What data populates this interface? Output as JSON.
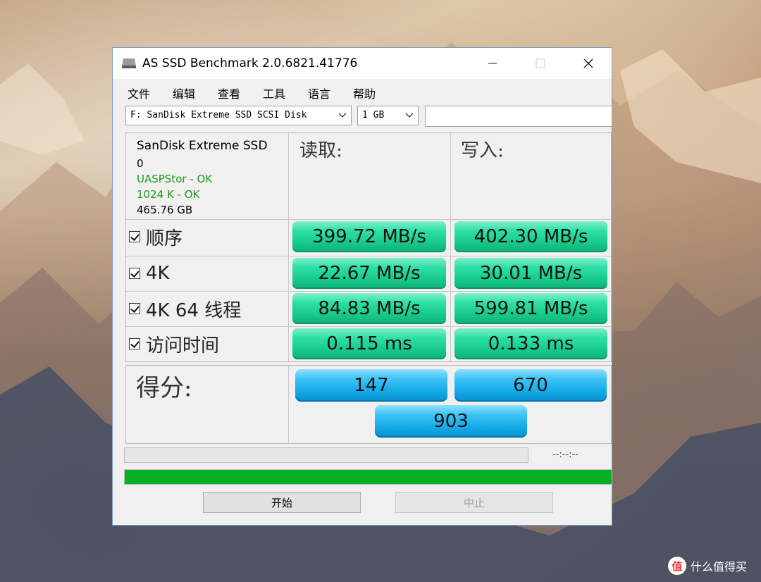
{
  "window": {
    "title": "AS SSD Benchmark 2.0.6821.41776"
  },
  "menu": [
    "文件",
    "编辑",
    "查看",
    "工具",
    "语言",
    "帮助"
  ],
  "controls": {
    "drive_select": "F: SanDisk Extreme SSD SCSI Disk",
    "size_select": "1 GB",
    "text_box": ""
  },
  "drive_info": {
    "name": "SanDisk Extreme SSD",
    "line2": "0",
    "driver_status": "UASPStor - OK",
    "alignment_status": "1024 K - OK",
    "capacity": "465.76 GB",
    "ok_color": "#1a9a1a"
  },
  "headers": {
    "read": "读取:",
    "write": "写入:"
  },
  "rows": [
    {
      "label": "顺序",
      "read": "399.72 MB/s",
      "write": "402.30 MB/s"
    },
    {
      "label": "4K",
      "read": "22.67 MB/s",
      "write": "30.01 MB/s"
    },
    {
      "label": "4K 64 线程",
      "read": "84.83 MB/s",
      "write": "599.81 MB/s"
    },
    {
      "label": "访问时间",
      "read": "0.115 ms",
      "write": "0.133 ms"
    }
  ],
  "score": {
    "label": "得分:",
    "read": "147",
    "write": "670",
    "total": "903"
  },
  "progress": {
    "time_text": "--:--:--",
    "bar1_fraction": 0,
    "bar2_fraction": 1,
    "bar_color": "#06b025"
  },
  "buttons": {
    "start": "开始",
    "stop": "中止"
  },
  "watermark": {
    "icon_text": "值",
    "text": "什么值得买"
  },
  "colors": {
    "result_green": "#16c98a",
    "score_blue": "#13a8e6"
  }
}
